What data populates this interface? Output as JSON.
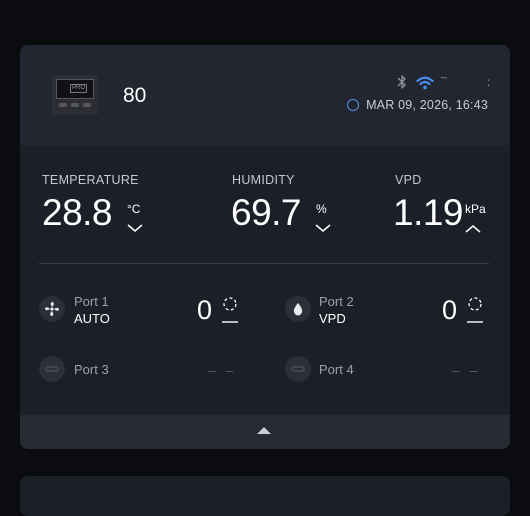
{
  "device": {
    "name": "80",
    "thumbnail_label": "PRO",
    "datetime": "MAR 09, 2026, 16:43",
    "status_tilde": "~",
    "menu_glyph": ":",
    "colors": {
      "wifi": "#4a8df0",
      "clock": "#5b8ae0",
      "bluetooth": "#8a8f99"
    }
  },
  "sensors": {
    "temperature": {
      "label": "TEMPERATURE",
      "value": "28.8",
      "unit": "°C",
      "trend": "down"
    },
    "humidity": {
      "label": "HUMIDITY",
      "value": "69.7",
      "unit": "%",
      "trend": "down"
    },
    "vpd": {
      "label": "VPD",
      "value": "1.19",
      "unit": "kPa",
      "trend": "up"
    }
  },
  "ports": [
    {
      "name": "Port 1",
      "mode": "AUTO",
      "level": "0",
      "icon": "fan-icon"
    },
    {
      "name": "Port 2",
      "mode": "VPD",
      "level": "0",
      "icon": "water-drop-icon"
    },
    {
      "name": "Port 3",
      "level": "– –",
      "icon": "plug-icon"
    },
    {
      "name": "Port 4",
      "level": "– –",
      "icon": "plug-icon"
    }
  ]
}
